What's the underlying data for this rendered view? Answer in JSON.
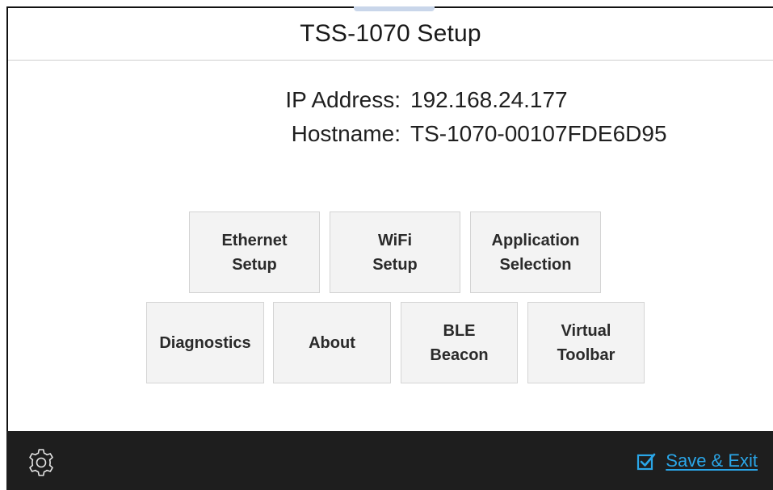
{
  "window": {
    "title": "TSS-1070 Setup"
  },
  "info": {
    "ip_label": "IP Address:",
    "ip_value": "192.168.24.177",
    "hostname_label": "Hostname:",
    "hostname_value": "TS-1070-00107FDE6D95"
  },
  "tiles": {
    "ethernet": "Ethernet\nSetup",
    "wifi": "WiFi\nSetup",
    "application": "Application\nSelection",
    "diagnostics": "Diagnostics",
    "about": "About",
    "ble": "BLE\nBeacon",
    "virtual_toolbar": "Virtual\nToolbar"
  },
  "footer": {
    "settings_icon": "gear-icon",
    "save_exit_label": "Save & Exit",
    "save_exit_icon": "checkbox-checked-icon",
    "accent_color": "#2aa6e8",
    "background_color": "#1e1e1e"
  }
}
